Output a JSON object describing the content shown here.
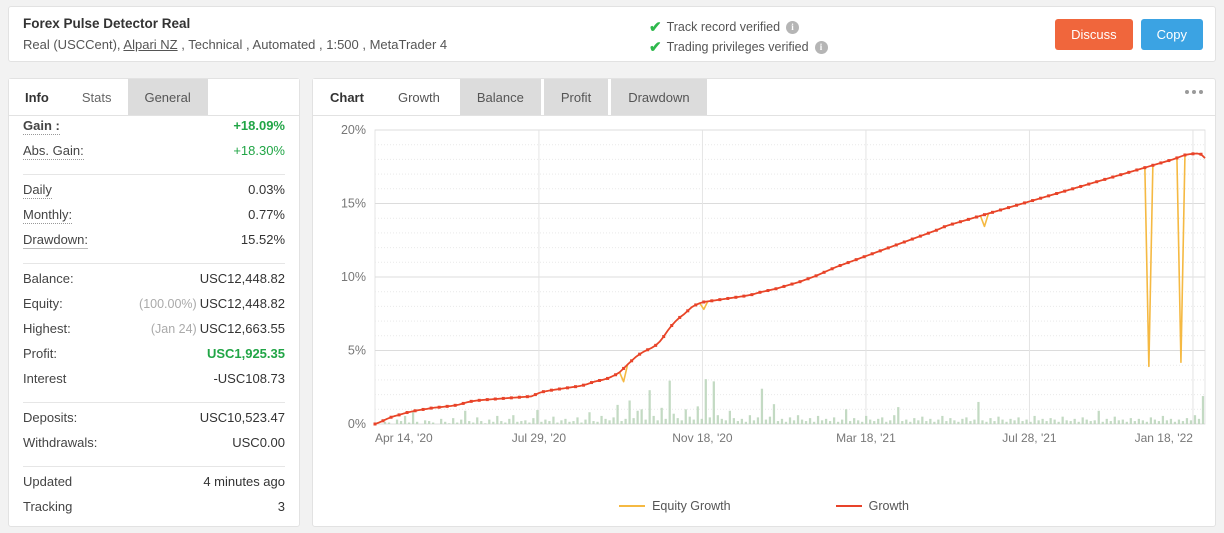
{
  "header": {
    "title": "Forex Pulse Detector Real",
    "subtitle_pre": "Real (USCCent), ",
    "broker_link": "Alpari NZ",
    "subtitle_post": " , Technical , Automated , 1:500 , MetaTrader 4",
    "verifications": [
      {
        "label": "Track record verified",
        "icon": "check-icon",
        "info": "i"
      },
      {
        "label": "Trading privileges verified",
        "icon": "check-icon",
        "info": "i"
      }
    ],
    "discuss_label": "Discuss",
    "copy_label": "Copy",
    "discuss_color": "#f0663c",
    "copy_color": "#3ba3e3",
    "check_color": "#2eb84c"
  },
  "sidebar": {
    "tabs": [
      {
        "label": "Info",
        "state": "active"
      },
      {
        "label": "Stats",
        "state": "white"
      },
      {
        "label": "General",
        "state": "grey"
      }
    ],
    "groups": [
      {
        "rows": [
          {
            "label": "Gain :",
            "value": "+18.09%",
            "underline": "dotted",
            "label_bold": true,
            "value_style": "greenb"
          },
          {
            "label": "Abs. Gain:",
            "value": "+18.30%",
            "underline": "dotted",
            "value_style": "green"
          }
        ]
      },
      {
        "rows": [
          {
            "label": "Daily",
            "value": "0.03%",
            "underline": "dotted"
          },
          {
            "label": "Monthly:",
            "value": "0.77%",
            "underline": "dotted"
          },
          {
            "label": "Drawdown:",
            "value": "15.52%",
            "underline": "solid"
          }
        ]
      },
      {
        "rows": [
          {
            "label": "Balance:",
            "value": "USC12,448.82"
          },
          {
            "label": "Equity:",
            "value": "USC12,448.82",
            "prefix": "(100.00%)"
          },
          {
            "label": "Highest:",
            "value": "USC12,663.55",
            "prefix": "(Jan 24)"
          },
          {
            "label": "Profit:",
            "value": "USC1,925.35",
            "value_style": "greenb"
          },
          {
            "label": "Interest",
            "value": "-USC108.73"
          }
        ]
      },
      {
        "rows": [
          {
            "label": "Deposits:",
            "value": "USC10,523.47"
          },
          {
            "label": "Withdrawals:",
            "value": "USC0.00"
          }
        ]
      },
      {
        "rows": [
          {
            "label": "Updated",
            "value": "4 minutes ago"
          },
          {
            "label": "Tracking",
            "value": "3"
          }
        ]
      }
    ]
  },
  "chart_panel": {
    "tabs": [
      {
        "label": "Chart",
        "state": "active"
      },
      {
        "label": "Growth",
        "state": "white"
      },
      {
        "label": "Balance",
        "state": "grey"
      },
      {
        "label": "Profit",
        "state": "grey"
      },
      {
        "label": "Drawdown",
        "state": "grey"
      }
    ],
    "menu_icon": "more-options-icon"
  },
  "chart_data": {
    "type": "line",
    "title": "",
    "xlabel": "",
    "ylabel": "",
    "ylim": [
      0,
      20
    ],
    "yticks": [
      "0%",
      "5%",
      "10%",
      "15%",
      "20%"
    ],
    "ytick_values": [
      0,
      5,
      10,
      15,
      20
    ],
    "grid": true,
    "minor_grid": true,
    "xticks": [
      "Apr 14, '20",
      "Jul 29, '20",
      "Nov 18, '20",
      "Mar 18, '21",
      "Jul 28, '21",
      "Jan 18, '22"
    ],
    "xtick_positions": [
      0,
      0.1975,
      0.3945,
      0.5915,
      0.7885,
      0.9855
    ],
    "legend_position": "bottom",
    "legend": [
      {
        "name": "Equity Growth",
        "color": "#f5b942"
      },
      {
        "name": "Growth",
        "color": "#e8432a"
      }
    ],
    "series": [
      {
        "name": "Growth",
        "color": "#e8432a",
        "markers": true,
        "values": [
          0.0,
          0.1,
          0.22,
          0.35,
          0.46,
          0.55,
          0.62,
          0.7,
          0.78,
          0.84,
          0.9,
          0.95,
          0.99,
          1.03,
          1.08,
          1.12,
          1.14,
          1.17,
          1.2,
          1.23,
          1.27,
          1.32,
          1.4,
          1.48,
          1.54,
          1.58,
          1.61,
          1.64,
          1.66,
          1.68,
          1.7,
          1.72,
          1.74,
          1.76,
          1.78,
          1.8,
          1.82,
          1.84,
          1.86,
          1.88,
          2.0,
          2.12,
          2.2,
          2.25,
          2.3,
          2.34,
          2.38,
          2.42,
          2.46,
          2.5,
          2.54,
          2.58,
          2.64,
          2.72,
          2.82,
          2.9,
          2.96,
          3.02,
          3.1,
          3.22,
          3.35,
          3.52,
          3.78,
          4.05,
          4.3,
          4.55,
          4.75,
          4.92,
          5.05,
          5.18,
          5.35,
          5.6,
          5.95,
          6.35,
          6.7,
          7.0,
          7.25,
          7.45,
          7.7,
          7.95,
          8.1,
          8.22,
          8.3,
          8.34,
          8.38,
          8.42,
          8.46,
          8.5,
          8.54,
          8.58,
          8.62,
          8.66,
          8.7,
          8.75,
          8.8,
          8.88,
          8.96,
          9.02,
          9.08,
          9.14,
          9.2,
          9.28,
          9.36,
          9.44,
          9.52,
          9.6,
          9.68,
          9.78,
          9.88,
          9.98,
          10.08,
          10.2,
          10.32,
          10.44,
          10.56,
          10.68,
          10.78,
          10.88,
          10.98,
          11.08,
          11.18,
          11.28,
          11.38,
          11.48,
          11.58,
          11.68,
          11.78,
          11.88,
          11.98,
          12.08,
          12.18,
          12.28,
          12.38,
          12.48,
          12.58,
          12.68,
          12.78,
          12.88,
          12.98,
          13.08,
          13.18,
          13.3,
          13.42,
          13.52,
          13.6,
          13.68,
          13.76,
          13.84,
          13.92,
          14.0,
          14.08,
          14.16,
          14.24,
          14.32,
          14.4,
          14.48,
          14.56,
          14.64,
          14.72,
          14.8,
          14.88,
          14.96,
          15.04,
          15.12,
          15.2,
          15.28,
          15.36,
          15.44,
          15.52,
          15.6,
          15.68,
          15.76,
          15.84,
          15.92,
          16.0,
          16.08,
          16.16,
          16.24,
          16.32,
          16.4,
          16.48,
          16.56,
          16.64,
          16.72,
          16.8,
          16.88,
          16.96,
          17.04,
          17.12,
          17.2,
          17.28,
          17.36,
          17.44,
          17.52,
          17.6,
          17.68,
          17.76,
          17.84,
          17.92,
          18.0,
          18.1,
          18.2,
          18.3,
          18.35,
          18.38,
          18.4,
          18.35,
          18.09
        ]
      },
      {
        "name": "Equity Growth",
        "color": "#f5b942",
        "markers": false,
        "dips": [
          {
            "index": 62,
            "depth": 0.9
          },
          {
            "index": 82,
            "depth": 0.5
          },
          {
            "index": 152,
            "depth": 0.8
          },
          {
            "index": 193,
            "depth": 13.6
          },
          {
            "index": 201,
            "depth": 14.0
          }
        ]
      }
    ],
    "bars": {
      "name": "Trades",
      "color": "#b9d3b9",
      "baseline": 0,
      "max_pct": 3.1,
      "values": [
        0.0,
        0.0,
        0.15,
        0.1,
        0.0,
        0.3,
        0.2,
        0.55,
        0.1,
        0.9,
        0.15,
        0.0,
        0.25,
        0.2,
        0.1,
        0.0,
        0.35,
        0.15,
        0.05,
        0.4,
        0.1,
        0.3,
        0.9,
        0.2,
        0.1,
        0.45,
        0.2,
        0.05,
        0.3,
        0.15,
        0.55,
        0.2,
        0.1,
        0.35,
        0.6,
        0.15,
        0.2,
        0.25,
        0.1,
        0.4,
        0.95,
        0.15,
        0.3,
        0.2,
        0.5,
        0.1,
        0.25,
        0.35,
        0.15,
        0.2,
        0.45,
        0.1,
        0.3,
        0.8,
        0.2,
        0.15,
        0.55,
        0.35,
        0.25,
        0.45,
        1.3,
        0.2,
        0.35,
        1.6,
        0.4,
        0.9,
        1.0,
        0.3,
        2.3,
        0.55,
        0.25,
        1.1,
        0.35,
        2.95,
        0.7,
        0.4,
        0.25,
        1.0,
        0.5,
        0.3,
        1.2,
        0.35,
        3.05,
        0.45,
        2.9,
        0.6,
        0.35,
        0.25,
        0.9,
        0.4,
        0.2,
        0.35,
        0.15,
        0.6,
        0.25,
        0.45,
        2.4,
        0.3,
        0.5,
        1.35,
        0.2,
        0.35,
        0.15,
        0.45,
        0.25,
        0.6,
        0.3,
        0.2,
        0.4,
        0.15,
        0.55,
        0.25,
        0.35,
        0.2,
        0.45,
        0.15,
        0.3,
        1.0,
        0.2,
        0.4,
        0.25,
        0.15,
        0.55,
        0.3,
        0.2,
        0.35,
        0.45,
        0.15,
        0.25,
        0.6,
        1.15,
        0.2,
        0.3,
        0.15,
        0.4,
        0.25,
        0.5,
        0.2,
        0.35,
        0.15,
        0.3,
        0.55,
        0.2,
        0.4,
        0.25,
        0.15,
        0.35,
        0.45,
        0.2,
        0.3,
        1.5,
        0.25,
        0.15,
        0.4,
        0.2,
        0.5,
        0.3,
        0.15,
        0.35,
        0.25,
        0.45,
        0.2,
        0.3,
        0.15,
        0.55,
        0.25,
        0.35,
        0.2,
        0.4,
        0.3,
        0.15,
        0.5,
        0.25,
        0.2,
        0.35,
        0.15,
        0.45,
        0.3,
        0.2,
        0.25,
        0.9,
        0.15,
        0.35,
        0.2,
        0.5,
        0.25,
        0.3,
        0.15,
        0.4,
        0.2,
        0.35,
        0.25,
        0.15,
        0.45,
        0.3,
        0.2,
        0.55,
        0.25,
        0.35,
        0.15,
        0.3,
        0.2,
        0.4,
        0.25,
        0.6,
        0.35,
        1.9
      ]
    }
  }
}
